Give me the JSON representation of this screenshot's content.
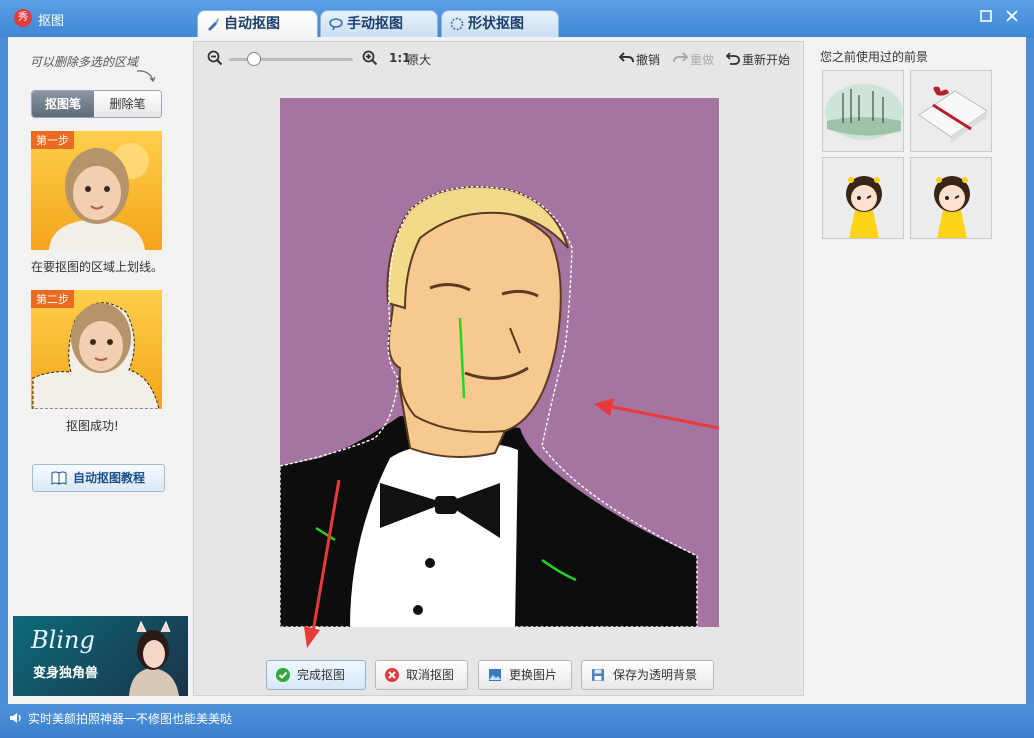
{
  "app": {
    "title": "抠图",
    "logo_text": "秀"
  },
  "tabs": [
    {
      "label": "自动抠图",
      "active": true
    },
    {
      "label": "手动抠图",
      "active": false
    },
    {
      "label": "形状抠图",
      "active": false
    }
  ],
  "left": {
    "hint": "可以删除多选的区域",
    "seg_pen": "抠图笔",
    "seg_eraser": "删除笔",
    "step1_badge": "第一步",
    "step1_caption": "在要抠图的区域上划线。",
    "step2_badge": "第二步",
    "step2_caption": "抠图成功!",
    "tutorial": "自动抠图教程",
    "ad_title": "Bling",
    "ad_sub": "变身独角兽"
  },
  "toolbar": {
    "zoom_ratio": "1:1",
    "original_size": "原大",
    "undo": "撤销",
    "redo": "重做",
    "restart": "重新开始",
    "zoom_level": 0.2
  },
  "actions": {
    "done": "完成抠图",
    "cancel": "取消抠图",
    "replace": "更换图片",
    "save_transparent": "保存为透明背景"
  },
  "right": {
    "title": "您之前使用过的前景"
  },
  "status": {
    "text": "实时美颜拍照神器一不修图也能美美哒"
  },
  "colors": {
    "photo_bg": "#a574a0",
    "stroke_green": "#1ed81e",
    "arrow_red": "#e83a3a",
    "titlebar": "#3f86d3"
  }
}
